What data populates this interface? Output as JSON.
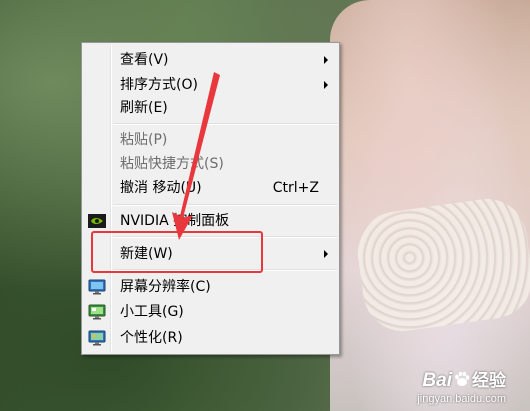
{
  "menu": {
    "items": [
      {
        "label": "查看(V)",
        "submenu": true
      },
      {
        "label": "排序方式(O)",
        "submenu": true
      },
      {
        "label": "刷新(E)"
      },
      {
        "label": "粘贴(P)",
        "disabled": true
      },
      {
        "label": "粘贴快捷方式(S)",
        "disabled": true
      },
      {
        "label": "撤消 移动(U)",
        "shortcut": "Ctrl+Z"
      },
      {
        "label": "NVIDIA 控制面板",
        "icon": "nvidia-icon"
      },
      {
        "label": "新建(W)",
        "submenu": true
      },
      {
        "label": "屏幕分辨率(C)",
        "icon": "display-resolution-icon"
      },
      {
        "label": "小工具(G)",
        "icon": "gadgets-icon"
      },
      {
        "label": "个性化(R)",
        "icon": "personalize-icon"
      }
    ]
  },
  "annotation": {
    "color": "#e8383d",
    "highlighted_item": "新建(W)"
  },
  "watermark": {
    "logo_left": "Bai",
    "logo_right": "经验",
    "url": "jingyan.baidu.com"
  },
  "colors": {
    "menu_bg": "#f0f0f0",
    "menu_border": "#979797",
    "disabled_text": "#6d6d6d",
    "annotation_red": "#e8383d"
  }
}
